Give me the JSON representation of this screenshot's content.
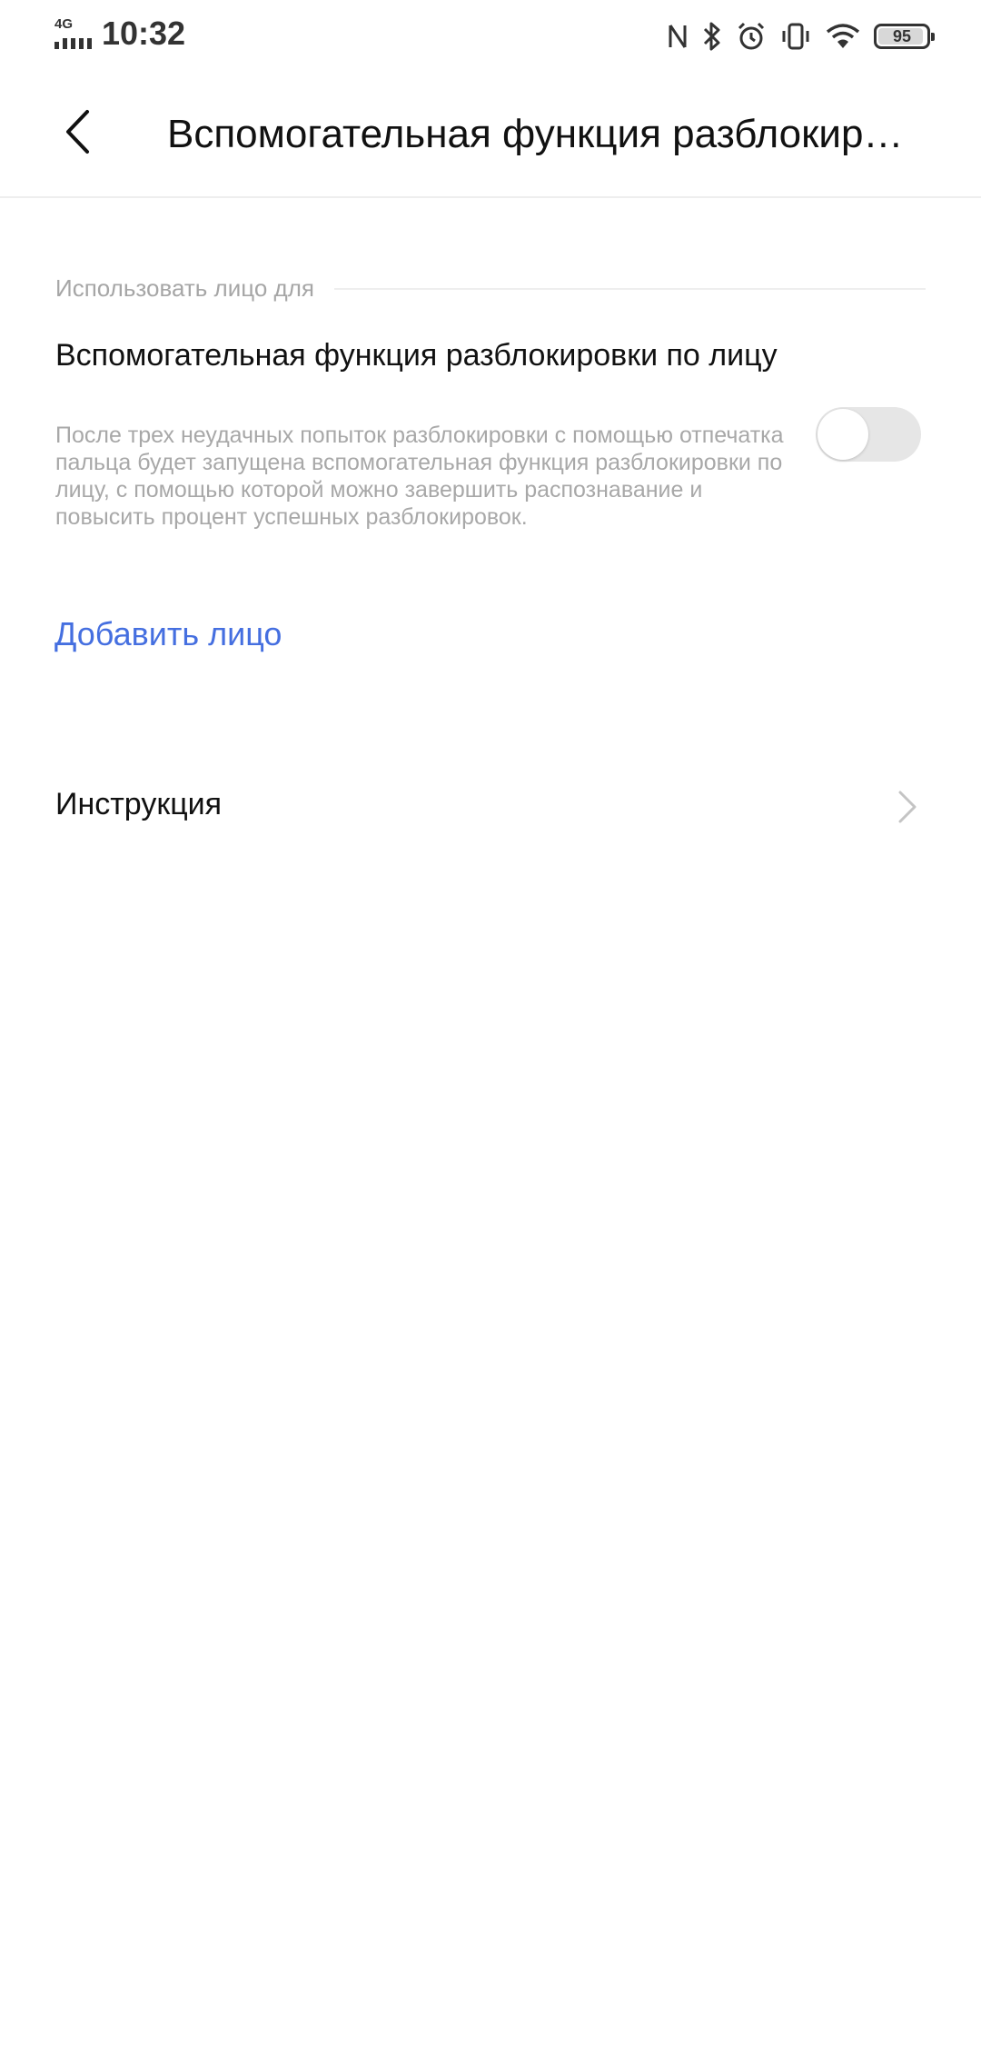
{
  "status_bar": {
    "network": "4G",
    "time": "10:32",
    "battery": "95",
    "battery_level": 0.95,
    "icons": [
      "nfc-icon",
      "bluetooth-icon",
      "alarm-icon",
      "vibrate-icon",
      "wifi-icon",
      "battery-icon"
    ]
  },
  "header": {
    "title": "Вспомогательная функция разблокировки по лицу",
    "back_icon": "chevron-left-icon"
  },
  "section": {
    "header": "Использовать лицо для"
  },
  "assist_setting": {
    "title": "Вспомогательная функция разблокировки по лицу",
    "description": "После трех неудачных попыток разблокировки с помощью отпечатка пальца будет запущена вспомогательная функция разблокировки по лицу, с помощью которой можно завершить распознавание и повысить процент успешных разблокировок.",
    "enabled": false
  },
  "add_face": {
    "label": "Добавить лицо"
  },
  "instructions": {
    "label": "Инструкция",
    "icon": "chevron-right-icon"
  },
  "colors": {
    "accent": "#456fe0",
    "secondary_text": "#a8a8a8",
    "divider": "#eeeeee",
    "toggle_off": "#e6e6e6"
  }
}
